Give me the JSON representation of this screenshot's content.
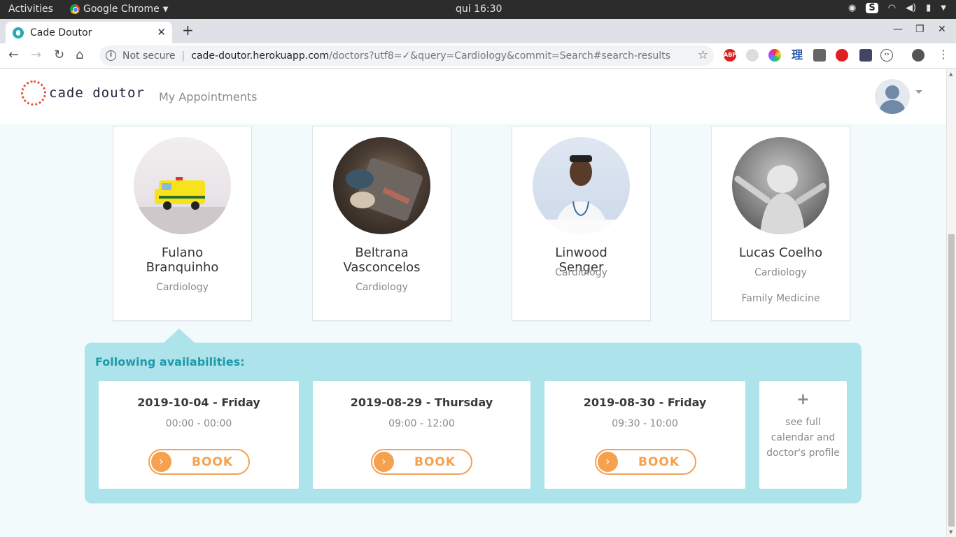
{
  "os": {
    "activities": "Activities",
    "app_name": "Google Chrome",
    "clock": "qui 16:30"
  },
  "browser": {
    "tab_title": "Cade Doutor",
    "not_secure": "Not secure",
    "url_host": "cade-doutor.herokuapp.com",
    "url_path": "/doctors?utf8=✓&query=Cardiology&commit=Search#search-results"
  },
  "header": {
    "logo_text": "cade doutor",
    "nav_appointments": "My Appointments"
  },
  "doctors": [
    {
      "name": "Fulano Branquinho",
      "specialties": [
        "Cardiology"
      ]
    },
    {
      "name": "Beltrana Vasconcelos",
      "specialties": [
        "Cardiology"
      ]
    },
    {
      "name": "Linwood Senger",
      "specialties": [
        "Cardiology"
      ]
    },
    {
      "name": "Lucas Coelho",
      "specialties": [
        "Cardiology",
        "Family Medicine"
      ]
    }
  ],
  "availability": {
    "title": "Following availabilities:",
    "slots": [
      {
        "date": "2019-10-04 - Friday",
        "time": "00:00 - 00:00",
        "button": "BOOK"
      },
      {
        "date": "2019-08-29 - Thursday",
        "time": "09:00 - 12:00",
        "button": "BOOK"
      },
      {
        "date": "2019-08-30 - Friday",
        "time": "09:30 - 10:00",
        "button": "BOOK"
      }
    ],
    "more": {
      "plus": "+",
      "text": "see full calendar and doctor's profile"
    }
  },
  "colors": {
    "accent_teal": "#1e9aa8",
    "panel_bg": "#ade4ec",
    "book_orange": "#f5a150"
  }
}
